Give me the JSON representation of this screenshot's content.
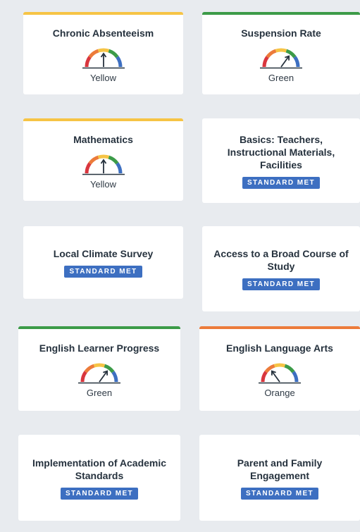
{
  "cards": [
    {
      "title": "Chronic Absenteeism",
      "type": "gauge",
      "status": "Yellow",
      "level": "yellow",
      "color": "#f6c445"
    },
    {
      "title": "Suspension Rate",
      "type": "gauge",
      "status": "Green",
      "level": "green",
      "color": "#3c9b48"
    },
    {
      "title": "Mathematics",
      "type": "gauge",
      "status": "Yellow",
      "level": "yellow",
      "color": "#f6c445"
    },
    {
      "title": "Basics: Teachers, Instructional Materials, Facilities",
      "type": "badge",
      "badge": "STANDARD MET"
    },
    {
      "title": "Local Climate Survey",
      "type": "badge",
      "badge": "STANDARD MET"
    },
    {
      "title": "Access to a Broad Course of Study",
      "type": "badge",
      "badge": "STANDARD MET"
    },
    {
      "title": "English Learner Progress",
      "type": "gauge",
      "status": "Green",
      "level": "green",
      "color": "#3c9b48"
    },
    {
      "title": "English Language Arts",
      "type": "gauge",
      "status": "Orange",
      "level": "orange",
      "color": "#ec7b3a"
    },
    {
      "title": "Implementation of Academic Standards",
      "type": "badge",
      "badge": "STANDARD MET"
    },
    {
      "title": "Parent and Family Engagement",
      "type": "badge",
      "badge": "STANDARD MET"
    }
  ],
  "gauge_colors": {
    "red": "#d9363e",
    "orange": "#ec7b3a",
    "yellow": "#f6c445",
    "green": "#3c9b48",
    "blue": "#3d6fc1"
  },
  "icons": {
    "gauge": "performance-gauge-icon"
  }
}
